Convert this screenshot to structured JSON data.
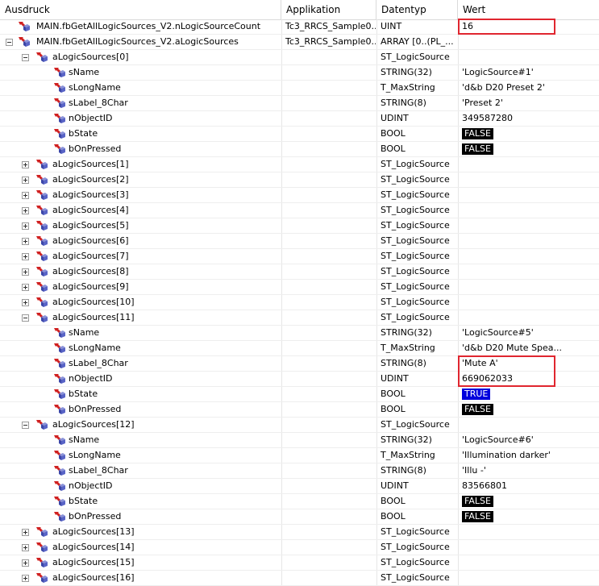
{
  "header": {
    "expr": "Ausdruck",
    "app": "Applikation",
    "type": "Datentyp",
    "value": "Wert"
  },
  "colors": {
    "accent_red": "#e0262f",
    "false_bg": "#000000",
    "true_bg": "#0000dd"
  },
  "rows": [
    {
      "depth": 0,
      "toggle": "none",
      "name": "MAIN.fbGetAllLogicSources_V2.nLogicSourceCount",
      "app": "Tc3_RRCS_Sample0...",
      "type": "UINT",
      "value": "16",
      "kind": "text"
    },
    {
      "depth": 0,
      "toggle": "minus",
      "name": "MAIN.fbGetAllLogicSources_V2.aLogicSources",
      "app": "Tc3_RRCS_Sample0...",
      "type": "ARRAY [0..(PL_...",
      "value": "",
      "kind": "text"
    },
    {
      "depth": 1,
      "toggle": "minus",
      "name": "aLogicSources[0]",
      "app": "",
      "type": "ST_LogicSource",
      "value": "",
      "kind": "text"
    },
    {
      "depth": 2,
      "toggle": "none",
      "name": "sName",
      "app": "",
      "type": "STRING(32)",
      "value": "'LogicSource#1'",
      "kind": "text"
    },
    {
      "depth": 2,
      "toggle": "none",
      "name": "sLongName",
      "app": "",
      "type": "T_MaxString",
      "value": "'d&b D20 Preset 2'",
      "kind": "text"
    },
    {
      "depth": 2,
      "toggle": "none",
      "name": "sLabel_8Char",
      "app": "",
      "type": "STRING(8)",
      "value": "'Preset 2'",
      "kind": "text"
    },
    {
      "depth": 2,
      "toggle": "none",
      "name": "nObjectID",
      "app": "",
      "type": "UDINT",
      "value": "349587280",
      "kind": "text"
    },
    {
      "depth": 2,
      "toggle": "none",
      "name": "bState",
      "app": "",
      "type": "BOOL",
      "value": "FALSE",
      "kind": "false"
    },
    {
      "depth": 2,
      "toggle": "none",
      "name": "bOnPressed",
      "app": "",
      "type": "BOOL",
      "value": "FALSE",
      "kind": "false"
    },
    {
      "depth": 1,
      "toggle": "plus",
      "name": "aLogicSources[1]",
      "app": "",
      "type": "ST_LogicSource",
      "value": "",
      "kind": "text"
    },
    {
      "depth": 1,
      "toggle": "plus",
      "name": "aLogicSources[2]",
      "app": "",
      "type": "ST_LogicSource",
      "value": "",
      "kind": "text"
    },
    {
      "depth": 1,
      "toggle": "plus",
      "name": "aLogicSources[3]",
      "app": "",
      "type": "ST_LogicSource",
      "value": "",
      "kind": "text"
    },
    {
      "depth": 1,
      "toggle": "plus",
      "name": "aLogicSources[4]",
      "app": "",
      "type": "ST_LogicSource",
      "value": "",
      "kind": "text"
    },
    {
      "depth": 1,
      "toggle": "plus",
      "name": "aLogicSources[5]",
      "app": "",
      "type": "ST_LogicSource",
      "value": "",
      "kind": "text"
    },
    {
      "depth": 1,
      "toggle": "plus",
      "name": "aLogicSources[6]",
      "app": "",
      "type": "ST_LogicSource",
      "value": "",
      "kind": "text"
    },
    {
      "depth": 1,
      "toggle": "plus",
      "name": "aLogicSources[7]",
      "app": "",
      "type": "ST_LogicSource",
      "value": "",
      "kind": "text"
    },
    {
      "depth": 1,
      "toggle": "plus",
      "name": "aLogicSources[8]",
      "app": "",
      "type": "ST_LogicSource",
      "value": "",
      "kind": "text"
    },
    {
      "depth": 1,
      "toggle": "plus",
      "name": "aLogicSources[9]",
      "app": "",
      "type": "ST_LogicSource",
      "value": "",
      "kind": "text"
    },
    {
      "depth": 1,
      "toggle": "plus",
      "name": "aLogicSources[10]",
      "app": "",
      "type": "ST_LogicSource",
      "value": "",
      "kind": "text"
    },
    {
      "depth": 1,
      "toggle": "minus",
      "name": "aLogicSources[11]",
      "app": "",
      "type": "ST_LogicSource",
      "value": "",
      "kind": "text"
    },
    {
      "depth": 2,
      "toggle": "none",
      "name": "sName",
      "app": "",
      "type": "STRING(32)",
      "value": "'LogicSource#5'",
      "kind": "text"
    },
    {
      "depth": 2,
      "toggle": "none",
      "name": "sLongName",
      "app": "",
      "type": "T_MaxString",
      "value": "'d&b D20 Mute Spea...",
      "kind": "text"
    },
    {
      "depth": 2,
      "toggle": "none",
      "name": "sLabel_8Char",
      "app": "",
      "type": "STRING(8)",
      "value": "'Mute A'",
      "kind": "text"
    },
    {
      "depth": 2,
      "toggle": "none",
      "name": "nObjectID",
      "app": "",
      "type": "UDINT",
      "value": "669062033",
      "kind": "text"
    },
    {
      "depth": 2,
      "toggle": "none",
      "name": "bState",
      "app": "",
      "type": "BOOL",
      "value": "TRUE",
      "kind": "true"
    },
    {
      "depth": 2,
      "toggle": "none",
      "name": "bOnPressed",
      "app": "",
      "type": "BOOL",
      "value": "FALSE",
      "kind": "false"
    },
    {
      "depth": 1,
      "toggle": "minus",
      "name": "aLogicSources[12]",
      "app": "",
      "type": "ST_LogicSource",
      "value": "",
      "kind": "text"
    },
    {
      "depth": 2,
      "toggle": "none",
      "name": "sName",
      "app": "",
      "type": "STRING(32)",
      "value": "'LogicSource#6'",
      "kind": "text"
    },
    {
      "depth": 2,
      "toggle": "none",
      "name": "sLongName",
      "app": "",
      "type": "T_MaxString",
      "value": "'Illumination darker'",
      "kind": "text"
    },
    {
      "depth": 2,
      "toggle": "none",
      "name": "sLabel_8Char",
      "app": "",
      "type": "STRING(8)",
      "value": "'Illu -'",
      "kind": "text"
    },
    {
      "depth": 2,
      "toggle": "none",
      "name": "nObjectID",
      "app": "",
      "type": "UDINT",
      "value": "83566801",
      "kind": "text"
    },
    {
      "depth": 2,
      "toggle": "none",
      "name": "bState",
      "app": "",
      "type": "BOOL",
      "value": "FALSE",
      "kind": "false"
    },
    {
      "depth": 2,
      "toggle": "none",
      "name": "bOnPressed",
      "app": "",
      "type": "BOOL",
      "value": "FALSE",
      "kind": "false"
    },
    {
      "depth": 1,
      "toggle": "plus",
      "name": "aLogicSources[13]",
      "app": "",
      "type": "ST_LogicSource",
      "value": "",
      "kind": "text"
    },
    {
      "depth": 1,
      "toggle": "plus",
      "name": "aLogicSources[14]",
      "app": "",
      "type": "ST_LogicSource",
      "value": "",
      "kind": "text"
    },
    {
      "depth": 1,
      "toggle": "plus",
      "name": "aLogicSources[15]",
      "app": "",
      "type": "ST_LogicSource",
      "value": "",
      "kind": "text"
    },
    {
      "depth": 1,
      "toggle": "plus",
      "name": "aLogicSources[16]",
      "app": "",
      "type": "ST_LogicSource",
      "value": "",
      "kind": "text"
    }
  ]
}
